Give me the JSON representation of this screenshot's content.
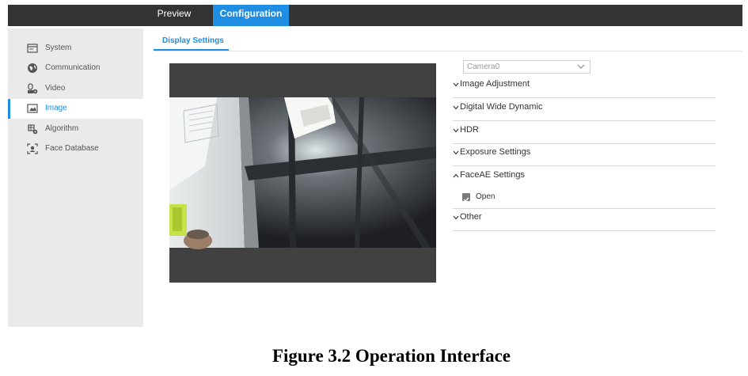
{
  "topbar": {
    "tabs": [
      {
        "label": "Preview"
      },
      {
        "label": "Configuration",
        "active": true
      }
    ]
  },
  "sidebar": {
    "items": [
      {
        "label": "System",
        "icon": "system-icon"
      },
      {
        "label": "Communication",
        "icon": "globe-icon"
      },
      {
        "label": "Video",
        "icon": "video-settings-icon"
      },
      {
        "label": "Image",
        "icon": "image-icon",
        "active": true
      },
      {
        "label": "Algorithm",
        "icon": "algorithm-icon"
      },
      {
        "label": "Face Database",
        "icon": "face-database-icon"
      }
    ]
  },
  "subtab": {
    "label": "Display Settings"
  },
  "camera_select": {
    "value": "Camera0"
  },
  "sections": [
    {
      "label": "Image Adjustment",
      "expanded": false
    },
    {
      "label": "Digital Wide Dynamic",
      "expanded": false
    },
    {
      "label": "HDR",
      "expanded": false
    },
    {
      "label": "Exposure Settings",
      "expanded": false
    },
    {
      "label": "FaceAE Settings",
      "expanded": true
    },
    {
      "label": "Other",
      "expanded": false
    }
  ],
  "faceae": {
    "open_label": "Open",
    "open_checked": true
  },
  "caption": "Figure 3.2 Operation Interface",
  "colors": {
    "accent": "#1e8de2",
    "topbar": "#333333",
    "sidebar": "#eaeaea",
    "video_bg": "#414141"
  }
}
